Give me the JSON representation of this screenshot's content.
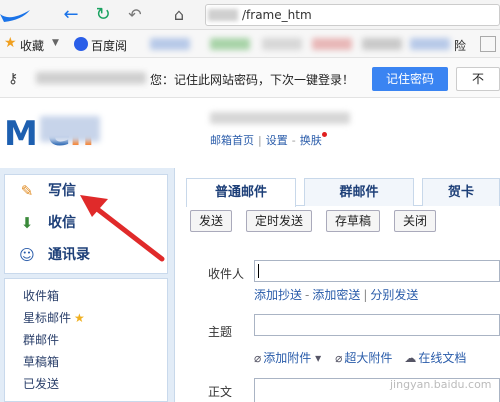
{
  "browser": {
    "url_tail": "/frame_htm"
  },
  "bookmarks": {
    "favorites_label": "收藏",
    "baidu_label": "百度阅",
    "tail_label": "险"
  },
  "password_bar": {
    "message": "您：记住此网站密码，下次一键登录！",
    "save_label": "记住密码",
    "no_label": "不"
  },
  "mail_header": {
    "logo": "M e",
    "logo_o": "n",
    "links": [
      "邮箱首页",
      "设置",
      "换肤"
    ]
  },
  "sidebar": {
    "nav": [
      {
        "label": "写信",
        "icon": "pencil-icon"
      },
      {
        "label": "收信",
        "icon": "inbox-icon"
      },
      {
        "label": "通讯录",
        "icon": "contacts-icon"
      }
    ],
    "folders": [
      "收件箱",
      "星标邮件",
      "群邮件",
      "草稿箱",
      "已发送"
    ]
  },
  "compose": {
    "tabs": [
      "普通邮件",
      "群邮件",
      "贺卡"
    ],
    "toolbar": [
      "发送",
      "定时发送",
      "存草稿",
      "关闭"
    ],
    "to_label": "收件人",
    "to_links": [
      "添加抄送",
      "添加密送",
      "分别发送"
    ],
    "subject_label": "主题",
    "attach": [
      "添加附件",
      "超大附件",
      "在线文档"
    ],
    "body_label": "正文"
  },
  "watermark": "jingyan.baidu.com"
}
